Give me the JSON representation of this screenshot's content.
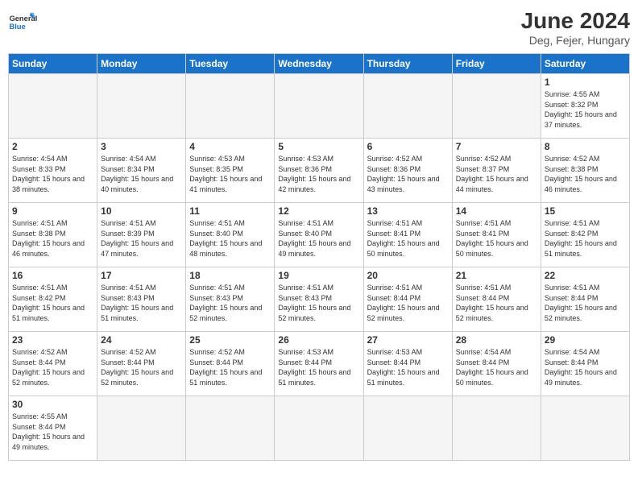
{
  "header": {
    "logo_general": "General",
    "logo_blue": "Blue",
    "title": "June 2024",
    "location": "Deg, Fejer, Hungary"
  },
  "weekdays": [
    "Sunday",
    "Monday",
    "Tuesday",
    "Wednesday",
    "Thursday",
    "Friday",
    "Saturday"
  ],
  "days": {
    "1": {
      "sunrise": "4:55 AM",
      "sunset": "8:32 PM",
      "daylight": "15 hours and 37 minutes."
    },
    "2": {
      "sunrise": "4:54 AM",
      "sunset": "8:33 PM",
      "daylight": "15 hours and 38 minutes."
    },
    "3": {
      "sunrise": "4:54 AM",
      "sunset": "8:34 PM",
      "daylight": "15 hours and 40 minutes."
    },
    "4": {
      "sunrise": "4:53 AM",
      "sunset": "8:35 PM",
      "daylight": "15 hours and 41 minutes."
    },
    "5": {
      "sunrise": "4:53 AM",
      "sunset": "8:36 PM",
      "daylight": "15 hours and 42 minutes."
    },
    "6": {
      "sunrise": "4:52 AM",
      "sunset": "8:36 PM",
      "daylight": "15 hours and 43 minutes."
    },
    "7": {
      "sunrise": "4:52 AM",
      "sunset": "8:37 PM",
      "daylight": "15 hours and 44 minutes."
    },
    "8": {
      "sunrise": "4:52 AM",
      "sunset": "8:38 PM",
      "daylight": "15 hours and 46 minutes."
    },
    "9": {
      "sunrise": "4:51 AM",
      "sunset": "8:38 PM",
      "daylight": "15 hours and 46 minutes."
    },
    "10": {
      "sunrise": "4:51 AM",
      "sunset": "8:39 PM",
      "daylight": "15 hours and 47 minutes."
    },
    "11": {
      "sunrise": "4:51 AM",
      "sunset": "8:40 PM",
      "daylight": "15 hours and 48 minutes."
    },
    "12": {
      "sunrise": "4:51 AM",
      "sunset": "8:40 PM",
      "daylight": "15 hours and 49 minutes."
    },
    "13": {
      "sunrise": "4:51 AM",
      "sunset": "8:41 PM",
      "daylight": "15 hours and 50 minutes."
    },
    "14": {
      "sunrise": "4:51 AM",
      "sunset": "8:41 PM",
      "daylight": "15 hours and 50 minutes."
    },
    "15": {
      "sunrise": "4:51 AM",
      "sunset": "8:42 PM",
      "daylight": "15 hours and 51 minutes."
    },
    "16": {
      "sunrise": "4:51 AM",
      "sunset": "8:42 PM",
      "daylight": "15 hours and 51 minutes."
    },
    "17": {
      "sunrise": "4:51 AM",
      "sunset": "8:43 PM",
      "daylight": "15 hours and 51 minutes."
    },
    "18": {
      "sunrise": "4:51 AM",
      "sunset": "8:43 PM",
      "daylight": "15 hours and 52 minutes."
    },
    "19": {
      "sunrise": "4:51 AM",
      "sunset": "8:43 PM",
      "daylight": "15 hours and 52 minutes."
    },
    "20": {
      "sunrise": "4:51 AM",
      "sunset": "8:44 PM",
      "daylight": "15 hours and 52 minutes."
    },
    "21": {
      "sunrise": "4:51 AM",
      "sunset": "8:44 PM",
      "daylight": "15 hours and 52 minutes."
    },
    "22": {
      "sunrise": "4:51 AM",
      "sunset": "8:44 PM",
      "daylight": "15 hours and 52 minutes."
    },
    "23": {
      "sunrise": "4:52 AM",
      "sunset": "8:44 PM",
      "daylight": "15 hours and 52 minutes."
    },
    "24": {
      "sunrise": "4:52 AM",
      "sunset": "8:44 PM",
      "daylight": "15 hours and 52 minutes."
    },
    "25": {
      "sunrise": "4:52 AM",
      "sunset": "8:44 PM",
      "daylight": "15 hours and 51 minutes."
    },
    "26": {
      "sunrise": "4:53 AM",
      "sunset": "8:44 PM",
      "daylight": "15 hours and 51 minutes."
    },
    "27": {
      "sunrise": "4:53 AM",
      "sunset": "8:44 PM",
      "daylight": "15 hours and 51 minutes."
    },
    "28": {
      "sunrise": "4:54 AM",
      "sunset": "8:44 PM",
      "daylight": "15 hours and 50 minutes."
    },
    "29": {
      "sunrise": "4:54 AM",
      "sunset": "8:44 PM",
      "daylight": "15 hours and 49 minutes."
    },
    "30": {
      "sunrise": "4:55 AM",
      "sunset": "8:44 PM",
      "daylight": "15 hours and 49 minutes."
    }
  }
}
